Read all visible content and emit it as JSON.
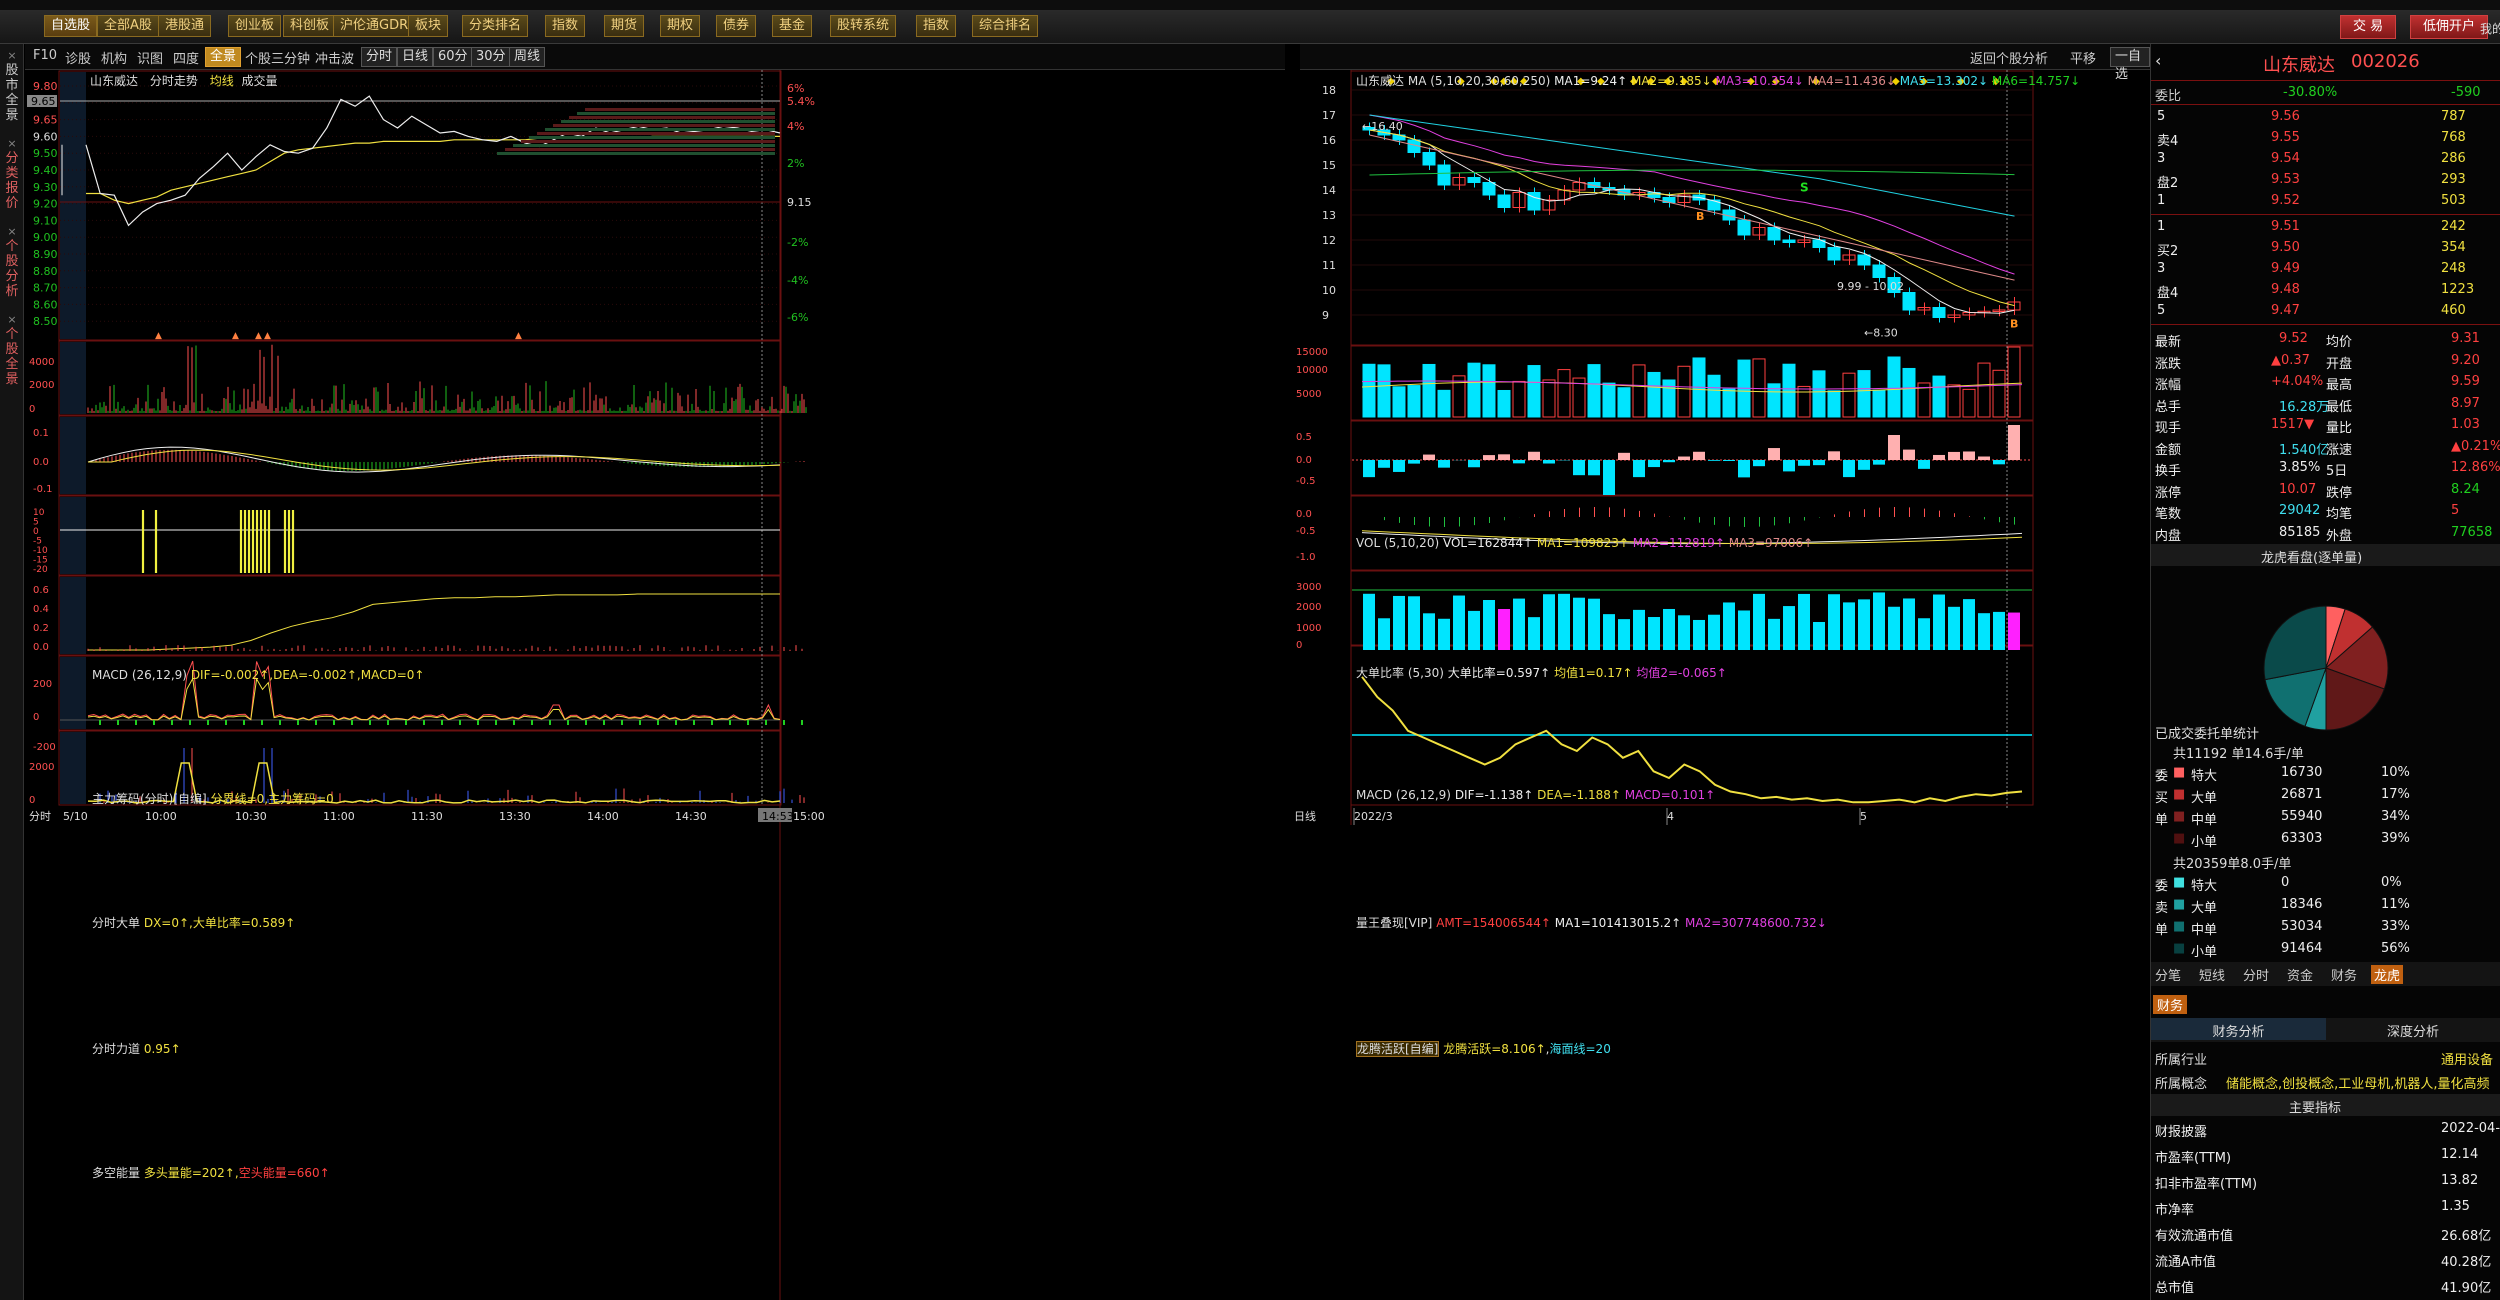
{
  "toolbar": {
    "items": [
      "自选股",
      "全部A股",
      "港股通",
      "创业板",
      "科创板",
      "沪伦通GDR",
      "板块",
      "分类排名",
      "指数",
      "期货",
      "期权",
      "债券",
      "基金",
      "股转系统",
      "指数",
      "综合排名"
    ],
    "trade": "交 易",
    "open_account": "低佣开户",
    "right_label": "我的"
  },
  "left_tabs": [
    "股市全景",
    "分类报价",
    "个股分析",
    "个股全景"
  ],
  "subbar": {
    "items": [
      "F10",
      "诊股",
      "机构",
      "识图",
      "四度"
    ],
    "selected": "全景",
    "tabs2": [
      "个股三分钟",
      "冲击波"
    ],
    "periods": [
      "分时",
      "日线",
      "60分",
      "30分",
      "周线"
    ],
    "right": [
      "返回个股分析",
      "平移",
      "一自选"
    ]
  },
  "intraday": {
    "title": "山东威达",
    "subtitle": "分时走势",
    "avg_label": "均线",
    "vol_label": "成交量",
    "price_ticks": [
      "9.80",
      "9.70",
      "9.65",
      "9.60",
      "9.50",
      "9.40",
      "9.30",
      "9.20",
      "9.10",
      "9.00",
      "8.90",
      "8.80",
      "8.70",
      "8.60",
      "8.50"
    ],
    "pct_ticks": [
      "6%",
      "5.4%",
      "4%",
      "2%",
      "9.15",
      "-2%",
      "-4%",
      "-6%"
    ],
    "vol_ticks": [
      "4000",
      "2000",
      "0"
    ],
    "macd_label": "MACD",
    "macd_params": "(26,12,9)",
    "macd_values": "DIF=-0.002↑,DEA=-0.002↑,MACD=0↑",
    "macd_ticks": [
      "0.1",
      "0.0",
      "-0.1"
    ],
    "zl_label": "主力筹码(分时)[自编]",
    "zl_values": "分界线=0,主力筹码=0",
    "zl_ticks": [
      "10",
      "5",
      "0",
      "-5",
      "-10",
      "-15",
      "-20"
    ],
    "dd_label": "分时大单",
    "dd_values": "DX=0↑,大单比率=0.589↑",
    "dd_ticks": [
      "0.6",
      "0.4",
      "0.2",
      "0.0"
    ],
    "ld_label": "分时力道",
    "ld_values": "0.95↑",
    "ld_ticks": [
      "200",
      "0",
      "-200"
    ],
    "dk_label": "多空能量",
    "dk_values": "多头量能=202↑,",
    "dk_values2": "空头能量=660↑",
    "dk_ticks": [
      "2000",
      "0"
    ],
    "time_labels": [
      "分时",
      "5/10",
      "10:00",
      "10:30",
      "11:00",
      "11:30",
      "13:30",
      "14:00",
      "14:30",
      "14:53",
      "15:00"
    ]
  },
  "kline": {
    "title": "山东威达",
    "ma_label": "MA",
    "ma_params": "(5,10,20,30,60,250)",
    "ma_values": [
      "MA1=9.24↑",
      "MA2=9.185↓",
      "MA3=10.354↓",
      "MA4=11.436↓",
      "MA5=13.302↓",
      "MA6=14.757↓"
    ],
    "price_ticks": [
      "18",
      "17",
      "16",
      "15",
      "14",
      "13",
      "12",
      "11",
      "10",
      "9"
    ],
    "annotations": {
      "high": "16.40",
      "range": "9.99 - 10.02",
      "low": "8.30",
      "s": "S",
      "b": "B"
    },
    "vol_label": "VOL",
    "vol_params": "(5,10,20)",
    "vol_values": [
      "VOL=162844↑",
      "MA1=109823↑",
      "MA2=112819↑",
      "MA3=97006↑"
    ],
    "vol_ticks": [
      "15000",
      "10000",
      "5000"
    ],
    "dd_label": "大单比率",
    "dd_params": "(5,30)",
    "dd_values": [
      "大单比率=0.597↑",
      "均值1=0.17↑",
      "均值2=-0.065↑"
    ],
    "dd_ticks": [
      "0.5",
      "0.0",
      "-0.5"
    ],
    "macd_label": "MACD",
    "macd_params": "(26,12,9)",
    "macd_values": [
      "DIF=-1.138↑",
      "DEA=-1.188↑",
      "MACD=0.101↑"
    ],
    "macd_ticks": [
      "0.0",
      "-0.5",
      "-1.0"
    ],
    "lw_label": "量王叠现[VIP]",
    "lw_values": [
      "AMT=154006544↑",
      "MA1=101413015.2↑",
      "MA2=307748600.732↓"
    ],
    "lw_ticks": [
      "3000",
      "2000",
      "1000",
      "0"
    ],
    "lt_label": "龙腾活跃[自编]",
    "lt_values": [
      "龙腾活跃=8.106↑",
      "海面线=20"
    ],
    "date_labels": [
      "日线",
      "2022/3",
      "4",
      "5"
    ]
  },
  "quote": {
    "name": "山东威达",
    "code": "002026",
    "weibi_label": "委比",
    "weibi": "-30.80%",
    "weicha": "-590",
    "sell": [
      [
        "9.56",
        "787"
      ],
      [
        "9.55",
        "768"
      ],
      [
        "9.54",
        "286"
      ],
      [
        "9.53",
        "293"
      ],
      [
        "9.52",
        "503"
      ]
    ],
    "buy": [
      [
        "9.51",
        "242"
      ],
      [
        "9.50",
        "354"
      ],
      [
        "9.49",
        "248"
      ],
      [
        "9.48",
        "1223"
      ],
      [
        "9.47",
        "460"
      ]
    ],
    "sell_labels": [
      "卖",
      "5",
      "4",
      "3",
      "盘2",
      "1"
    ],
    "stats": [
      [
        "最新",
        "9.52",
        "均价",
        "9.31"
      ],
      [
        "涨跌",
        "▲0.37",
        "开盘",
        "9.20"
      ],
      [
        "涨幅",
        "+4.04%",
        "最高",
        "9.59"
      ],
      [
        "总手",
        "16.28万",
        "最低",
        "8.97"
      ],
      [
        "现手",
        "1517▼",
        "量比",
        "1.03"
      ],
      [
        "金额",
        "1.540亿",
        "涨速",
        "▲0.21%"
      ],
      [
        "换手",
        "3.85%",
        "5日",
        "12.86%"
      ],
      [
        "涨停",
        "10.07",
        "跌停",
        "8.24"
      ],
      [
        "笔数",
        "29042",
        "均笔",
        "5"
      ],
      [
        "内盘",
        "85185",
        "外盘",
        "77658"
      ]
    ],
    "lh_title": "龙虎看盘(逐单量)",
    "entrust_title": "已成交委托单统计",
    "buy_total": "共11192 单14.6手/单",
    "sell_total": "共20359单8.0手/单",
    "buy_rows": [
      [
        "委",
        "特大",
        "16730",
        "10%"
      ],
      [
        "买",
        "大单",
        "26871",
        "17%"
      ],
      [
        "单",
        "中单",
        "55940",
        "34%"
      ],
      [
        "",
        "小单",
        "63303",
        "39%"
      ]
    ],
    "sell_rows": [
      [
        "委",
        "特大",
        "0",
        "0%"
      ],
      [
        "卖",
        "大单",
        "18346",
        "11%"
      ],
      [
        "单",
        "中单",
        "53034",
        "33%"
      ],
      [
        "",
        "小单",
        "91464",
        "56%"
      ]
    ],
    "tabs": [
      "分笔",
      "短线",
      "分时",
      "资金",
      "财务",
      "龙虎"
    ],
    "fin_tab": "财务",
    "fin_sub": [
      "财务分析",
      "深度分析"
    ],
    "industry_label": "所属行业",
    "industry": "通用设备",
    "concept_label": "所属概念",
    "concept": "储能概念,创投概念,工业母机,机器人,量化高频",
    "main_index": "主要指标",
    "fin_rows": [
      [
        "财报披露",
        "2022-04-26"
      ],
      [
        "市盈率(TTM)",
        "12.14"
      ],
      [
        "扣非市盈率(TTM)",
        "13.82"
      ],
      [
        "市净率",
        "1.35"
      ],
      [
        "有效流通市值",
        "26.68亿"
      ],
      [
        "流通A市值",
        "40.28亿"
      ],
      [
        "总市值",
        "41.90亿"
      ]
    ]
  },
  "colors": {
    "up": "#ff4040",
    "down": "#20d020",
    "cyan": "#00e5ff",
    "yellow": "#f0e040",
    "frame": "#6a1010"
  }
}
